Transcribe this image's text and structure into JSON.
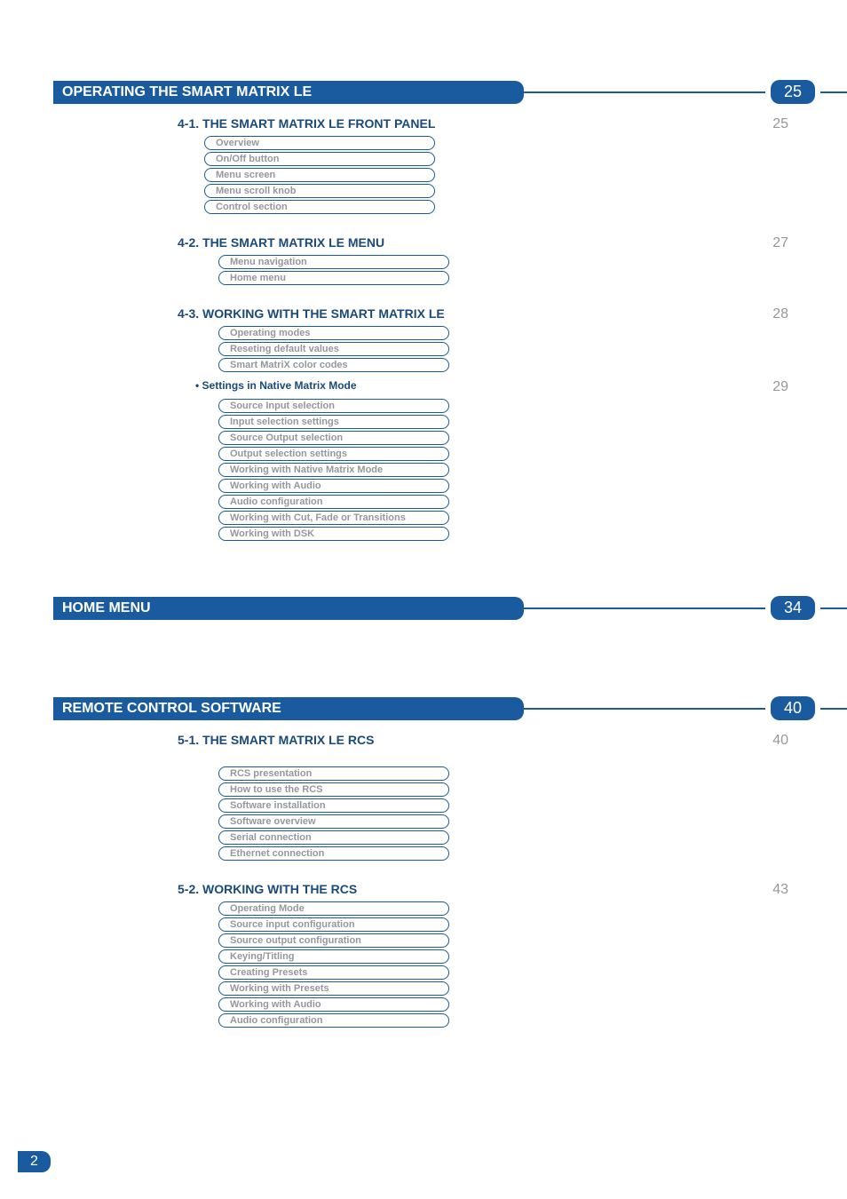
{
  "footer_page": "2",
  "chapters": [
    {
      "title": "OPERATING THE SMART MATRIX LE",
      "page": "25",
      "sections": [
        {
          "title": "4-1. THE SMART MATRIX LE FRONT PANEL",
          "page": "25",
          "items": [
            "Overview",
            "On/Off button",
            "Menu screen",
            "Menu scroll knob",
            "Control section"
          ]
        },
        {
          "title": "4-2. THE SMART MATRIX LE MENU",
          "page": "27",
          "items": [
            "Menu navigation",
            "Home menu"
          ],
          "indent": true
        },
        {
          "title": "4-3. WORKING WITH THE SMART MATRIX LE",
          "page": "28",
          "items": [
            "Operating modes",
            "Reseting default values",
            "Smart MatriX color codes"
          ],
          "indent": true,
          "subgroups": [
            {
              "bullet": "•  Settings in Native Matrix Mode",
              "page": "29",
              "items": [
                "Source Input selection",
                "Input selection settings",
                "Source Output selection",
                "Output selection settings",
                "Working with Native Matrix Mode",
                "Working with Audio",
                "Audio configuration",
                "Working with Cut, Fade or Transitions",
                "Working with DSK"
              ]
            }
          ]
        }
      ]
    },
    {
      "title": "HOME MENU",
      "page": "34",
      "sections": []
    },
    {
      "title": "REMOTE CONTROL SOFTWARE",
      "page": "40",
      "sections": [
        {
          "title": "5-1. THE SMART MATRIX LE RCS",
          "page": "40",
          "items": [
            "RCS presentation",
            "How to use the RCS",
            "Software installation",
            "Software overview",
            "Serial connection",
            "Ethernet connection"
          ],
          "indent": true
        },
        {
          "title": "5-2. WORKING WITH THE RCS",
          "page": "43",
          "items": [
            "Operating Mode",
            "Source input configuration",
            "Source output configuration",
            "Keying/Titling",
            "Creating Presets",
            "Working with Presets",
            "Working with Audio",
            "Audio configuration"
          ],
          "indent": true
        }
      ]
    }
  ]
}
